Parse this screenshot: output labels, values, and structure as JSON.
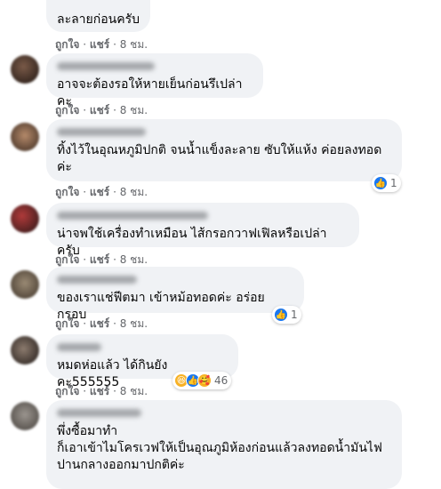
{
  "actions": {
    "like": "ถูกใจ",
    "dot": "·",
    "share": "แชร์",
    "time": "8 ชม."
  },
  "comments": [
    {
      "text": "ละลายก่อนครับ"
    },
    {
      "text": "อาจจะต้องรอให้หายเย็นก่อนรึเปล่าคะ"
    },
    {
      "text": "ทิ้งไว้ในอุณหภูมิปกติ จนน้ำแข็งละลาย ซับให้แห้ง ค่อยลงทอด\nค่ะ",
      "reaction_count": "1"
    },
    {
      "text": "น่าจพใช้เครื่องทำเหมือน ไส้กรอกวาฟเฟิลหรือเปล่าครับ"
    },
    {
      "text": "ของเราแช่ฟีตมา เข้าหม้อทอดค่ะ อร่อยกรอบ",
      "reaction_count": "1"
    },
    {
      "text": "หมดห่อแล้ว ได้กินยังคะ555555",
      "reaction_count": "46"
    },
    {
      "text": "พึ่งซื้อมาทำ\nก็เอาเข้าไมโครเวฟให้เป็นอุณภูมิห้องก่อนแล้วลงทอดน้ำมันไฟ\nปานกลางออกมาปกติค่ะ"
    }
  ],
  "colors": {
    "bubble": "#f0f2f5",
    "like": "#1877f2",
    "meta": "#65676b"
  }
}
